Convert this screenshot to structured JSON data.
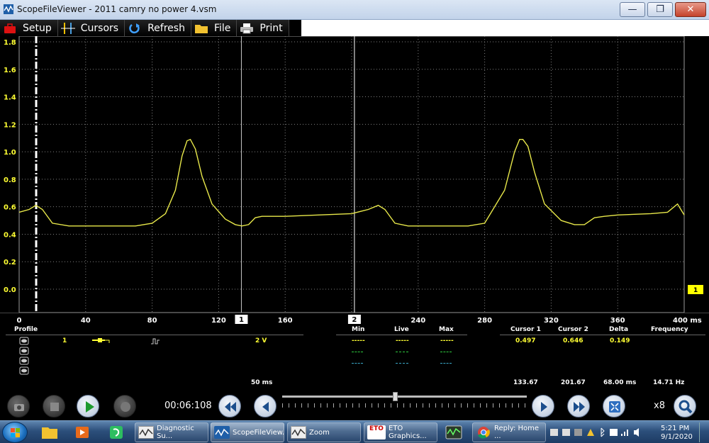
{
  "window": {
    "title": "ScopeFileViewer - 2011 camry no power 4.vsm",
    "min_glyph": "—",
    "max_glyph": "❐",
    "close_glyph": "✕"
  },
  "toolbar": {
    "setup": "Setup",
    "cursors": "Cursors",
    "refresh": "Refresh",
    "file": "File",
    "print": "Print"
  },
  "scope": {
    "trace_color": "#e8e84a",
    "grid_color": "#808080",
    "y_ticks": [
      "1.8",
      "1.6",
      "1.4",
      "1.2",
      "1.0",
      "0.8",
      "0.6",
      "0.4",
      "0.2",
      "0.0"
    ],
    "x_ticks": [
      "0",
      "40",
      "80",
      "120",
      "160",
      "240",
      "280",
      "320",
      "360",
      "400 ms"
    ],
    "cursor1_tag": "1",
    "cursor2_tag": "2",
    "channel_tag": "1"
  },
  "panel": {
    "profile_header": "Profile",
    "channel_number": "1",
    "scale": "2 V",
    "min_header": "Min",
    "live_header": "Live",
    "max_header": "Max",
    "min_val": "-----",
    "live_val": "-----",
    "max_val": "-----",
    "cursor1_header": "Cursor 1",
    "cursor2_header": "Cursor 2",
    "delta_header": "Delta",
    "frequency_header": "Frequency",
    "cursor1_val": "0.497",
    "cursor2_val": "0.646",
    "delta_val": "0.149",
    "timebase": "50 ms",
    "cursor1_time": "133.67",
    "cursor2_time": "201.67",
    "delta_time": "68.00 ms",
    "frequency_val": "14.71 Hz"
  },
  "controls": {
    "elapsed": "00:06:108",
    "zoom": "x8"
  },
  "taskbar": {
    "items": [
      "Diagnostic Su...",
      "ScopeFileView...",
      "Zoom",
      "ETO Graphics...",
      "Reply: Home ..."
    ],
    "eto_label": "ETO",
    "time": "5:21 PM",
    "date": "9/1/2020"
  },
  "chart_data": {
    "type": "line",
    "title": "",
    "xlabel": "",
    "ylabel": "",
    "xlim": [
      0,
      400
    ],
    "ylim": [
      0,
      1.8
    ],
    "grid": true,
    "series": [
      {
        "x": [
          0,
          6,
          10,
          14,
          20,
          30,
          50,
          70,
          80,
          88,
          94,
          98,
          101,
          103,
          106,
          110,
          116,
          124,
          130,
          134,
          138,
          142,
          146,
          160,
          180,
          200,
          210,
          216,
          220,
          226,
          234,
          250,
          270,
          280,
          292,
          298,
          301,
          303,
          306,
          310,
          316,
          326,
          334,
          340,
          346,
          352,
          360,
          380,
          390,
          396,
          400
        ],
        "y": [
          0.56,
          0.58,
          0.61,
          0.58,
          0.48,
          0.46,
          0.46,
          0.46,
          0.48,
          0.55,
          0.72,
          0.97,
          1.08,
          1.09,
          1.02,
          0.82,
          0.62,
          0.51,
          0.47,
          0.46,
          0.47,
          0.52,
          0.53,
          0.53,
          0.54,
          0.55,
          0.58,
          0.61,
          0.58,
          0.48,
          0.46,
          0.46,
          0.46,
          0.48,
          0.72,
          1.0,
          1.09,
          1.09,
          1.04,
          0.85,
          0.62,
          0.5,
          0.47,
          0.47,
          0.52,
          0.53,
          0.54,
          0.55,
          0.56,
          0.62,
          0.54
        ]
      }
    ],
    "cursors": [
      133.67,
      201.67
    ]
  }
}
